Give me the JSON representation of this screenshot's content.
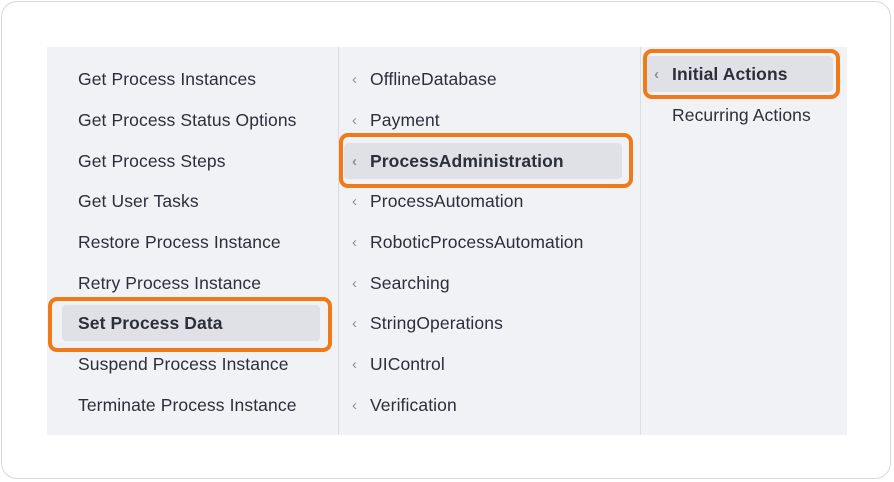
{
  "col1": {
    "items": [
      "Get Process Instances",
      "Get Process Status Options",
      "Get Process Steps",
      "Get User Tasks",
      "Restore Process Instance",
      "Retry Process Instance",
      "Set Process Data",
      "Suspend Process Instance",
      "Terminate Process Instance"
    ]
  },
  "col2": {
    "items": [
      "OfflineDatabase",
      "Payment",
      "ProcessAdministration",
      "ProcessAutomation",
      "RoboticProcessAutomation",
      "Searching",
      "StringOperations",
      "UIControl",
      "Verification"
    ]
  },
  "col3": {
    "items": [
      "Initial Actions",
      "Recurring Actions"
    ]
  },
  "colors": {
    "highlight": "#f07a1a",
    "panel": "#f1f2f5",
    "selected": "#e0e1e6"
  },
  "icons": {
    "expand": "chevron-left-icon"
  }
}
